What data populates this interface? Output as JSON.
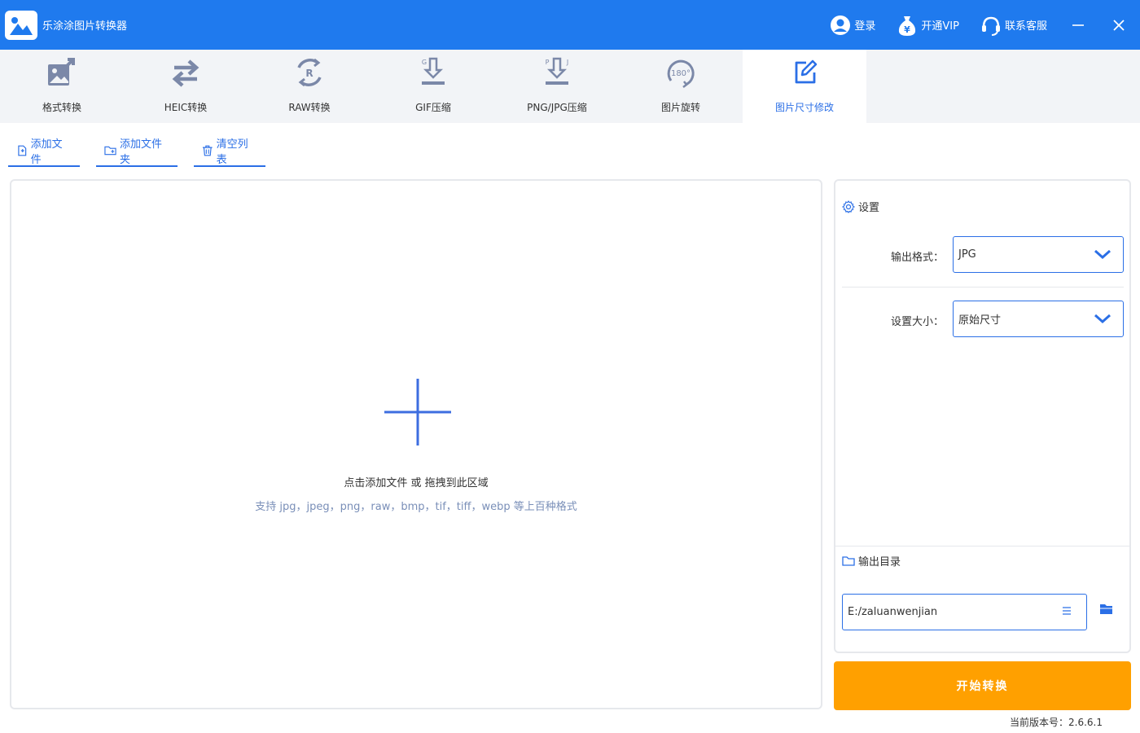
{
  "app": {
    "title": "乐涂涂图片转换器",
    "accent": "#1f7aee"
  },
  "titlebar": {
    "login_label": "登录",
    "vip_label": "开通VIP",
    "support_label": "联系客服"
  },
  "tools": [
    {
      "label": "格式转换",
      "icon": "format-convert-icon"
    },
    {
      "label": "HEIC转换",
      "icon": "heic-convert-icon"
    },
    {
      "label": "RAW转换",
      "icon": "raw-convert-icon"
    },
    {
      "label": "GIF压缩",
      "icon": "gif-compress-icon"
    },
    {
      "label": "PNG/JPG压缩",
      "icon": "png-jpg-compress-icon"
    },
    {
      "label": "图片旋转",
      "icon": "rotate-icon"
    },
    {
      "label": "图片尺寸修改",
      "icon": "resize-icon",
      "active": true
    }
  ],
  "file_actions": {
    "add_file": "添加文件",
    "add_folder": "添加文件夹",
    "clear_list": "清空列表"
  },
  "dropzone": {
    "main_text": "点击添加文件 或 拖拽到此区域",
    "sub_text": "支持 jpg，jpeg，png，raw，bmp，tif，tiff，webp 等上百种格式"
  },
  "settings": {
    "title": "设置",
    "format_label": "输出格式：",
    "format_value": "JPG",
    "size_label": "设置大小：",
    "size_value": "原始尺寸",
    "output_dir_label": "输出目录",
    "output_dir_value": "E:/zaluanwenjian"
  },
  "start_button": "开始转换",
  "version_text": "当前版本号：2.6.6.1",
  "colors": {
    "primary": "#2b6fe6",
    "start": "#ffa000",
    "border": "#e6e8ec"
  }
}
